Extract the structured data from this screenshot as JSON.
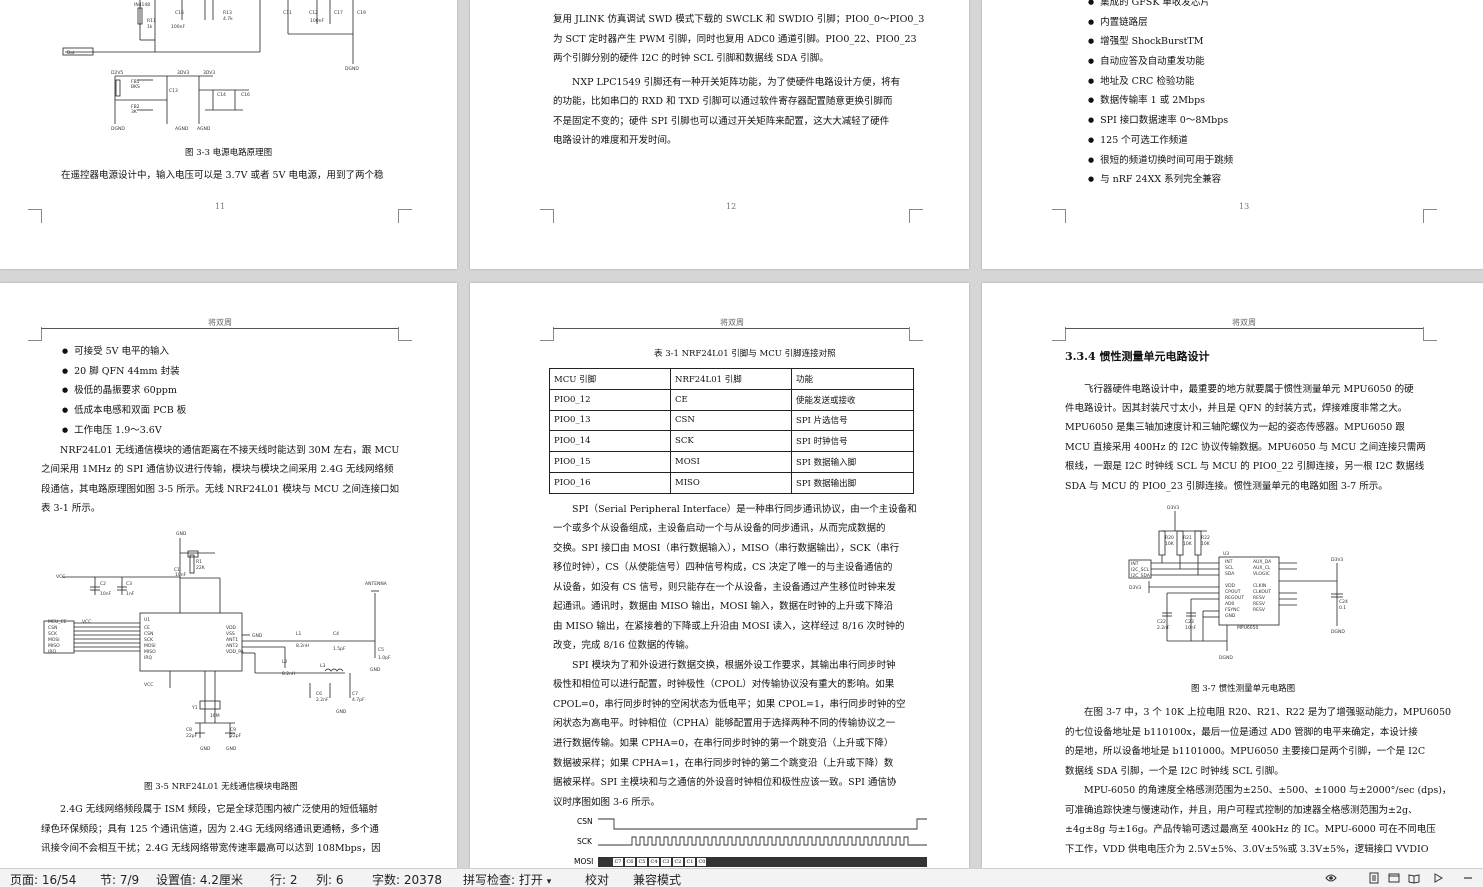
{
  "status_bar": {
    "page": "页面: 16/54",
    "section": "节: 7/9",
    "setting": "设置值: 4.2厘米",
    "row": "行: 2",
    "column": "列: 6",
    "word_count": "字数: 20378",
    "spellcheck": "拼写检查: 打开",
    "spellcheck_arrow": "▾",
    "proofread": "校对",
    "compat_mode": "兼容模式"
  },
  "page11": {
    "figure_caption": "图 3-3 电源电路原理图",
    "body_text": "在遥控器电源设计中，输入电压可以是 3.7V 或者 5V 电电源，用到了两个稳",
    "page_number": "11",
    "circuit_labels": [
      "IN4148",
      "R11",
      "1k",
      "C16",
      "100nF",
      "R13",
      "4.7k",
      "C11",
      "C12",
      "C17",
      "C18",
      "100nF",
      "C19",
      "VCC",
      "Bat",
      "D2V5",
      "3DV3",
      "R20",
      "FB1",
      "R21",
      "BKS",
      "FB2",
      "3K",
      "C13",
      "C14",
      "C15",
      "C16",
      "DGND",
      "AGND",
      "AGND",
      "DGND",
      "AGND"
    ]
  },
  "page12": {
    "lines": [
      "复用 JLINK 仿真调试 SWD 模式下载的 SWCLK 和 SWDIO 引脚；PIO0_0～PIO0_3",
      "为 SCT 定时器产生 PWM 引脚，同时也复用 ADC0 通道引脚。PIO0_22、PIO0_23",
      "两个引脚分别的硬件 I2C 的时钟 SCL 引脚和数据线 SDA 引脚。",
      "NXP LPC1549 引脚还有一种开关矩阵功能，为了使硬件电路设计方便，将有",
      "的功能，比如串口的 RXD 和 TXD 引脚可以通过软件寄存器配置随意更换引脚而",
      "不是固定不变的；硬件 SPI 引脚也可以通过开关矩阵来配置，这大大减轻了硬件",
      "电路设计的难度和开发时间。"
    ],
    "page_number": "12"
  },
  "page13": {
    "bullets": [
      "集成的 GFSK 单收发芯片",
      "内置链路层",
      "增强型 ShockBurstTM",
      "自动应答及自动重发功能",
      "地址及 CRC 检验功能",
      "数据传输率 1 或 2Mbps",
      "SPI 接口数据速率 0～8Mbps",
      "125 个可选工作频道",
      "很短的频道切换时间可用于跳频",
      "与 nRF 24XX 系列完全兼容"
    ],
    "page_number": "13"
  },
  "page14": {
    "header": "将双周",
    "bullets": [
      "可接受 5V 电平的输入",
      "20 脚 QFN 44mm 封装",
      "极低的晶振要求 60ppm",
      "低成本电感和双面 PCB 板",
      "工作电压 1.9～3.6V"
    ],
    "para1": [
      "NRF24L01 无线通信模块的通信距离在不接天线时能达到 30M 左右，跟 MCU",
      "之间采用 1MHz 的 SPI 通信协议进行传输，模块与模块之间采用 2.4G 无线网络频",
      "段通信，其电路原理图如图 3-5 所示。无线 NRF24L01 模块与 MCU 之间连接口如",
      "表 3-1 所示。"
    ],
    "figure_caption": "图 3-5 NRF24L01 无线通信模块电路图",
    "para2": [
      "2.4G 无线网络频段属于 ISM 频段，它是全球范围内被广泛使用的短低辐射",
      "绿色环保频段；具有 125 个通讯信道，因为 2.4G 无线网络通讯更通畅，多个通",
      "讯接令间不会相互干扰；2.4G 无线网络带宽传速率最高可以达到 108Mbps，因"
    ],
    "circuit_labels": [
      "GND",
      "C1",
      "R1",
      "22K",
      "VCC",
      "C2",
      "10nF",
      "C3",
      "1nF",
      "ANTENNA",
      "MCU_CE",
      "CSN",
      "SCK",
      "MOSI",
      "MISO",
      "IRQ",
      "VCC",
      "CE",
      "CSN",
      "SCK",
      "MOSI",
      "MISO",
      "IRQ",
      "U1",
      "VDD",
      "VSS",
      "ANT1",
      "ANT2",
      "VDD_PA",
      "GND",
      "L1",
      "8.2nH",
      "C4",
      "1.5pF",
      "L2",
      "8.2nH",
      "L3",
      "3.9nH",
      "C5",
      "1.0pF",
      "C6",
      "2.2nF",
      "C7",
      "4.7pF",
      "Y1",
      "16M",
      "C8",
      "22pF",
      "C9",
      "22pF",
      "GND",
      "GND"
    ]
  },
  "page15": {
    "header": "将双周",
    "table_caption": "表 3-1 NRF24L01 引脚与 MCU 引脚连接对照",
    "table": {
      "headers": [
        "MCU 引脚",
        "NRF24L01 引脚",
        "功能"
      ],
      "rows": [
        [
          "PIO0_12",
          "CE",
          "使能发送或接收"
        ],
        [
          "PIO0_13",
          "CSN",
          "SPI 片选信号"
        ],
        [
          "PIO0_14",
          "SCK",
          "SPI 时钟信号"
        ],
        [
          "PIO0_15",
          "MOSI",
          "SPI 数据输入脚"
        ],
        [
          "PIO0_16",
          "MISO",
          "SPI 数据输出脚"
        ]
      ]
    },
    "para1": [
      "SPI（Serial Peripheral Interface）是一种串行同步通讯协议，由一个主设备和",
      "一个或多个从设备组成，主设备启动一个与从设备的同步通讯，从而完成数据的",
      "交换。SPI 接口由 MOSI（串行数据输入），MISO（串行数据输出），SCK（串行",
      "移位时钟），CS（从使能信号）四种信号构成，CS 决定了唯一的与主设备通信的",
      "从设备，如没有 CS 信号，则只能存在一个从设备，主设备通过产生移位时钟来发",
      "起通讯。通讯时，数据由 MISO 输出，MOSI 输入，数据在时钟的上升或下降沿",
      "由 MISO 输出，在紧接着的下降或上升沿由 MOSI 读入，这样经过 8/16 次时钟的",
      "改变，完成 8/16 位数据的传输。"
    ],
    "para2": [
      "SPI 模块为了和外设进行数据交换，根据外设工作要求，其输出串行同步时钟",
      "极性和相位可以进行配置，时钟极性（CPOL）对传输协议没有重大的影响。如果",
      "CPOL=0，串行同步时钟的空闲状态为低电平；如果 CPOL=1，串行同步时钟的空",
      "闲状态为高电平。时钟相位（CPHA）能够配置用于选择两种不同的传输协议之一",
      "进行数据传输。如果 CPHA=0，在串行同步时钟的第一个跳变沿（上升或下降）",
      "数据被采样；如果 CPHA=1，在串行同步时钟的第二个跳变沿（上升或下降）数",
      "据被采样。SPI 主模块和与之通信的外设音时钟相位和极性应该一致。SPI 通信协",
      "议时序图如图 3-6 所示。"
    ],
    "timing_labels": [
      "CSN",
      "SCK",
      "MOSI"
    ],
    "mosi_bits": [
      "C7",
      "C6",
      "C5",
      "C4",
      "C3",
      "C2",
      "C1",
      "C0"
    ]
  },
  "page16": {
    "header": "将双周",
    "section_heading": "3.3.4  惯性测量单元电路设计",
    "para1": [
      "飞行器硬件电路设计中，最重要的地方就要属于惯性测量单元 MPU6050 的硬",
      "件电路设计。因其封装尺寸太小，并且是 QFN 的封装方式，焊接难度非常之大。",
      "MPU6050 是集三轴加速度计和三轴陀螺仪为一起的姿态传感器。MPU6050 跟",
      "MCU 直接采用 400Hz 的 I2C 协议传输数据。MPU6050 与 MCU 之间连接只需两",
      "根线，一跟是 I2C 时钟线 SCL 与 MCU 的 PIO0_22 引脚连接，另一根 I2C 数据线",
      "SDA 与 MCU 的 PIO0_23 引脚连接。惯性测量单元的电路如图 3-7 所示。"
    ],
    "figure_caption": "图 3-7 惯性测量单元电路图",
    "para2": [
      "在图 3-7 中，3 个 10K 上拉电阻 R20、R21、R22 是为了增强驱动能力，MPU6050",
      "的七位设备地址是 b110100x，最后一位是通过 AD0 管脚的电平来确定，本设计接",
      "的是地，所以设备地址是 b1101000。MPU6050 主要接口是两个引脚，一个是 I2C",
      "数据线 SDA 引脚，一个是 I2C 时钟线 SCL 引脚。"
    ],
    "para3": [
      "MPU-6050 的角速度全格感测范围为±250、±500、±1000 与±2000°/sec (dps)，",
      "可准确追踪快速与慢速动作，并且，用户可程式控制的加速器全格感测范围为±2g、",
      "±4g±8g 与±16g。产品传输可透过最高至 400kHz 的 IC。MPU-6000 可在不同电压",
      "下工作，VDD 供电电压介为 2.5V±5%、3.0V±5%或 3.3V±5%，逻辑接口 VVDIO"
    ],
    "circuit_labels": [
      "D3V3",
      "R20",
      "10K",
      "R21",
      "10K",
      "R22",
      "10K",
      "INT",
      "I2C_SCL",
      "I2C_SDA",
      "D3V3",
      "U3",
      "INT",
      "SCL",
      "SDA",
      "VDD",
      "VLOGIC",
      "AUX_DA",
      "AUX_CL",
      "CLKIN",
      "CLKOUT",
      "FSYNC",
      "REGOUT",
      "CPOUT",
      "AD0",
      "RESV",
      "RESV",
      "RESV",
      "GND",
      "MPU6050",
      "C22",
      "2.2nF",
      "C23",
      "10nF",
      "C24",
      "0.1",
      "DGND",
      "DGND"
    ]
  }
}
